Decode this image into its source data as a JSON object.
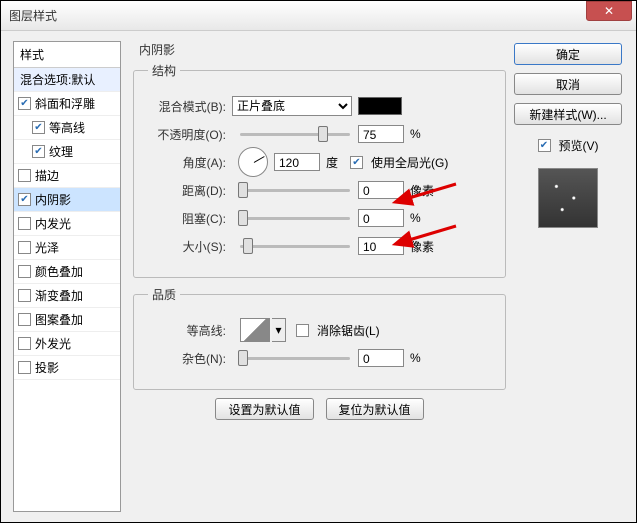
{
  "window": {
    "title": "图层样式"
  },
  "styleList": {
    "header": "样式",
    "blendDefault": "混合选项:默认",
    "items": [
      {
        "label": "斜面和浮雕",
        "checked": true,
        "indent": false
      },
      {
        "label": "等高线",
        "checked": true,
        "indent": true
      },
      {
        "label": "纹理",
        "checked": true,
        "indent": true
      },
      {
        "label": "描边",
        "checked": false,
        "indent": false
      },
      {
        "label": "内阴影",
        "checked": true,
        "indent": false,
        "selected": true
      },
      {
        "label": "内发光",
        "checked": false,
        "indent": false
      },
      {
        "label": "光泽",
        "checked": false,
        "indent": false
      },
      {
        "label": "颜色叠加",
        "checked": false,
        "indent": false
      },
      {
        "label": "渐变叠加",
        "checked": false,
        "indent": false
      },
      {
        "label": "图案叠加",
        "checked": false,
        "indent": false
      },
      {
        "label": "外发光",
        "checked": false,
        "indent": false
      },
      {
        "label": "投影",
        "checked": false,
        "indent": false
      }
    ]
  },
  "panel": {
    "title": "内阴影",
    "structure": {
      "legend": "结构",
      "blendModeLabel": "混合模式(B):",
      "blendModeValue": "正片叠底",
      "colorHex": "#000000",
      "opacityLabel": "不透明度(O):",
      "opacityValue": "75",
      "opacityUnit": "%",
      "angleLabel": "角度(A):",
      "angleValue": "120",
      "angleUnit": "度",
      "globalLightLabel": "使用全局光(G)",
      "globalLightChecked": true,
      "distanceLabel": "距离(D):",
      "distanceValue": "0",
      "distanceUnit": "像素",
      "chokeLabel": "阻塞(C):",
      "chokeValue": "0",
      "chokeUnit": "%",
      "sizeLabel": "大小(S):",
      "sizeValue": "10",
      "sizeUnit": "像素"
    },
    "quality": {
      "legend": "品质",
      "contourLabel": "等高线:",
      "antiAliasLabel": "消除锯齿(L)",
      "antiAliasChecked": false,
      "noiseLabel": "杂色(N):",
      "noiseValue": "0",
      "noiseUnit": "%"
    },
    "buttons": {
      "makeDefault": "设置为默认值",
      "resetDefault": "复位为默认值"
    }
  },
  "right": {
    "ok": "确定",
    "cancel": "取消",
    "newStyle": "新建样式(W)...",
    "previewLabel": "预览(V)",
    "previewChecked": true
  }
}
